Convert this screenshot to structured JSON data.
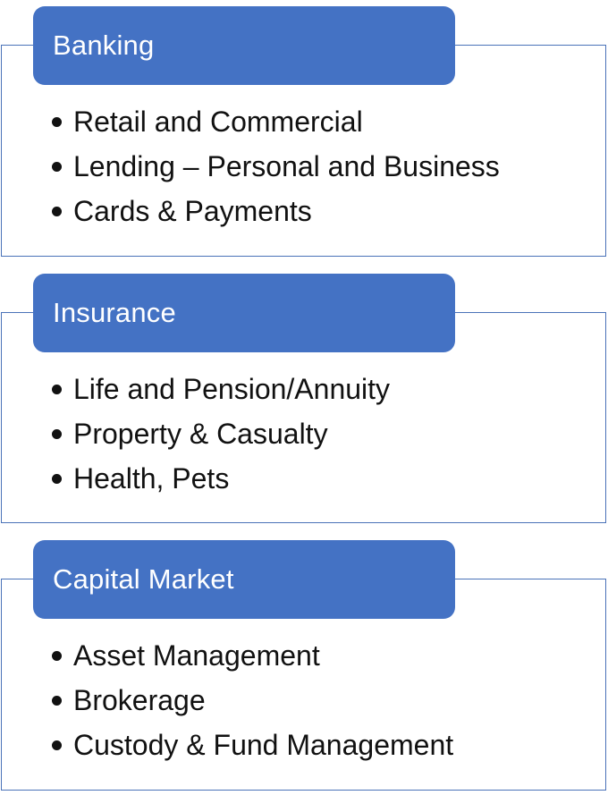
{
  "sections": [
    {
      "title": "Banking",
      "items": [
        "Retail and Commercial",
        "Lending – Personal and Business",
        "Cards & Payments"
      ]
    },
    {
      "title": "Insurance",
      "items": [
        "Life and Pension/Annuity",
        "Property & Casualty",
        "Health, Pets"
      ]
    },
    {
      "title": "Capital Market",
      "items": [
        "Asset Management",
        "Brokerage",
        "Custody & Fund Management"
      ]
    }
  ],
  "colors": {
    "header_fill": "#4472c4",
    "panel_border": "#4a72b8",
    "header_text": "#ffffff",
    "item_text": "#111111"
  }
}
